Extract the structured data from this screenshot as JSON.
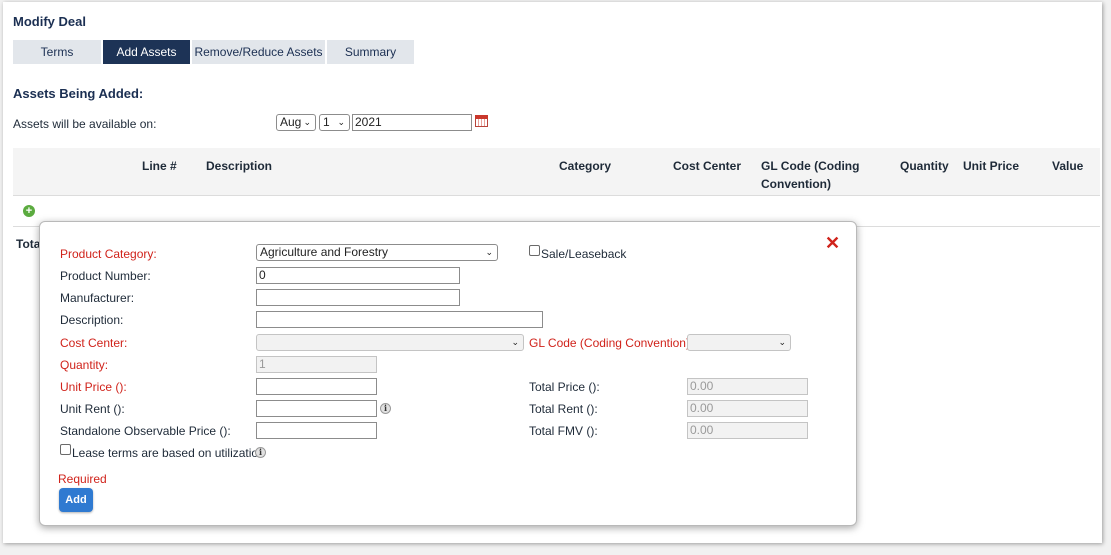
{
  "page": {
    "title": "Modify Deal",
    "tabs": [
      "Terms",
      "Add Assets",
      "Remove/Reduce Assets",
      "Summary"
    ]
  },
  "section": {
    "title": "Assets Being Added:",
    "available_label": "Assets will be available on:",
    "month": "Aug",
    "day": "1",
    "year": "2021"
  },
  "table": {
    "headers": [
      "Line #",
      "Description",
      "Category",
      "Cost Center",
      "GL Code (Coding",
      "Convention)",
      "Quantity",
      "Unit Price",
      "Value"
    ],
    "total_label": "Tota"
  },
  "modal": {
    "product_category_label": "Product Category:",
    "product_category_value": "Agriculture and Forestry",
    "sale_leaseback_label": "Sale/Leaseback",
    "product_number_label": "Product Number:",
    "product_number_value": "0",
    "manufacturer_label": "Manufacturer:",
    "manufacturer_value": "",
    "description_label": "Description:",
    "description_value": "",
    "cost_center_label": "Cost Center:",
    "cost_center_value": "",
    "gl_code_label": "GL Code (Coding Convention):",
    "gl_code_value": "",
    "quantity_label": "Quantity:",
    "quantity_value": "1",
    "unit_price_label": "Unit Price ():",
    "unit_price_value": "",
    "total_price_label": "Total Price ():",
    "total_price_value": "0.00",
    "unit_rent_label": "Unit Rent ():",
    "unit_rent_value": "",
    "total_rent_label": "Total Rent ():",
    "total_rent_value": "0.00",
    "sop_label": "Standalone Observable Price ():",
    "sop_value": "",
    "total_fmv_label": "Total FMV ():",
    "total_fmv_value": "0.00",
    "lease_terms_label": "Lease terms are based on utilization",
    "required_label": "Required",
    "add_label": "Add",
    "info_glyph": "i",
    "close_glyph": "✕"
  },
  "icons": {
    "plus": "+",
    "chevron": "⌄"
  },
  "colors": {
    "active_tab": "#1d3356",
    "required": "#d0231b",
    "add_button": "#2f7ad1",
    "plus_icon": "#5bab3f"
  }
}
